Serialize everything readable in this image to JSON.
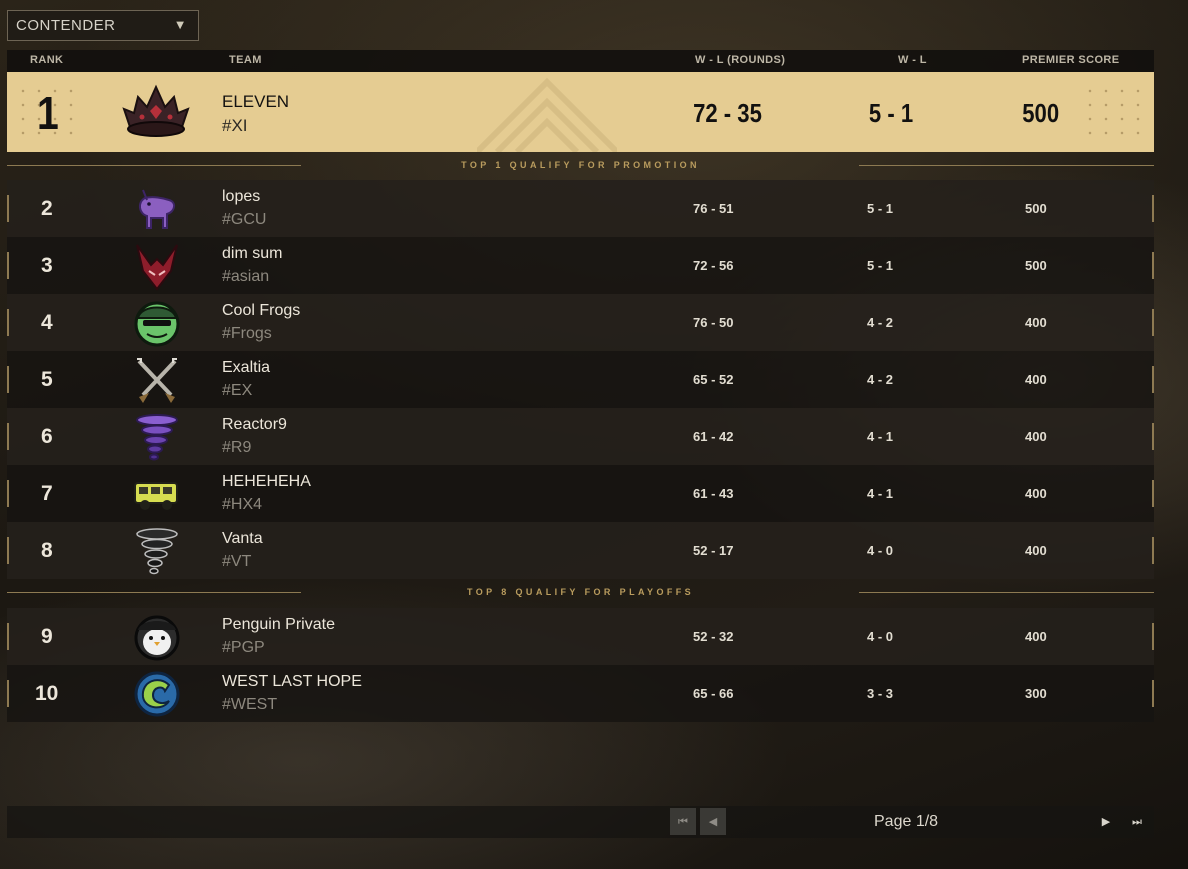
{
  "league_select": {
    "value": "CONTENDER",
    "icon": "chevron-down-icon"
  },
  "headers": {
    "rank": "RANK",
    "team": "TEAM",
    "wl_rounds": "W - L (ROUNDS)",
    "wl": "W - L",
    "premier_score": "PREMIER SCORE"
  },
  "leader": {
    "rank": "1",
    "name": "ELEVEN",
    "tag": "#XI",
    "wl_rounds": "72 - 35",
    "wl": "5 - 1",
    "premier_score": "500",
    "logo": "crown-icon"
  },
  "dividers": {
    "promotion": "TOP 1 QUALIFY FOR PROMOTION",
    "playoffs": "TOP 8 QUALIFY FOR PLAYOFFS"
  },
  "rows": [
    {
      "rank": "2",
      "name": "lopes",
      "tag": "#GCU",
      "wl_rounds": "76 - 51",
      "wl": "5 - 1",
      "premier_score": "500",
      "logo": "unicorn-icon"
    },
    {
      "rank": "3",
      "name": "dim sum",
      "tag": "#asian",
      "wl_rounds": "72 - 56",
      "wl": "5 - 1",
      "premier_score": "500",
      "logo": "red-demon-icon"
    },
    {
      "rank": "4",
      "name": "Cool Frogs",
      "tag": "#Frogs",
      "wl_rounds": "76 - 50",
      "wl": "4 - 2",
      "premier_score": "400",
      "logo": "frog-icon"
    },
    {
      "rank": "5",
      "name": "Exaltia",
      "tag": "#EX",
      "wl_rounds": "65 - 52",
      "wl": "4 - 2",
      "premier_score": "400",
      "logo": "crossed-swords-icon"
    },
    {
      "rank": "6",
      "name": "Reactor9",
      "tag": "#R9",
      "wl_rounds": "61 - 42",
      "wl": "4 - 1",
      "premier_score": "400",
      "logo": "purple-tornado-icon"
    },
    {
      "rank": "7",
      "name": "HEHEHEHA",
      "tag": "#HX4",
      "wl_rounds": "61 - 43",
      "wl": "4 - 1",
      "premier_score": "400",
      "logo": "yellow-truck-icon"
    },
    {
      "rank": "8",
      "name": "Vanta",
      "tag": "#VT",
      "wl_rounds": "52 - 17",
      "wl": "4 - 0",
      "premier_score": "400",
      "logo": "black-tornado-icon"
    },
    {
      "rank": "9",
      "name": "Penguin Private",
      "tag": "#PGP",
      "wl_rounds": "52 - 32",
      "wl": "4 - 0",
      "premier_score": "400",
      "logo": "penguin-icon"
    },
    {
      "rank": "10",
      "name": "WEST LAST HOPE",
      "tag": "#WEST",
      "wl_rounds": "65 - 66",
      "wl": "3 - 3",
      "premier_score": "300",
      "logo": "wave-icon"
    }
  ],
  "pager": {
    "page_label": "Page 1/8"
  },
  "colors": {
    "leader_bg": "#e5cc92",
    "gold_accent": "#b99c5e",
    "row_odd": "#24201b",
    "row_even": "#161411"
  }
}
